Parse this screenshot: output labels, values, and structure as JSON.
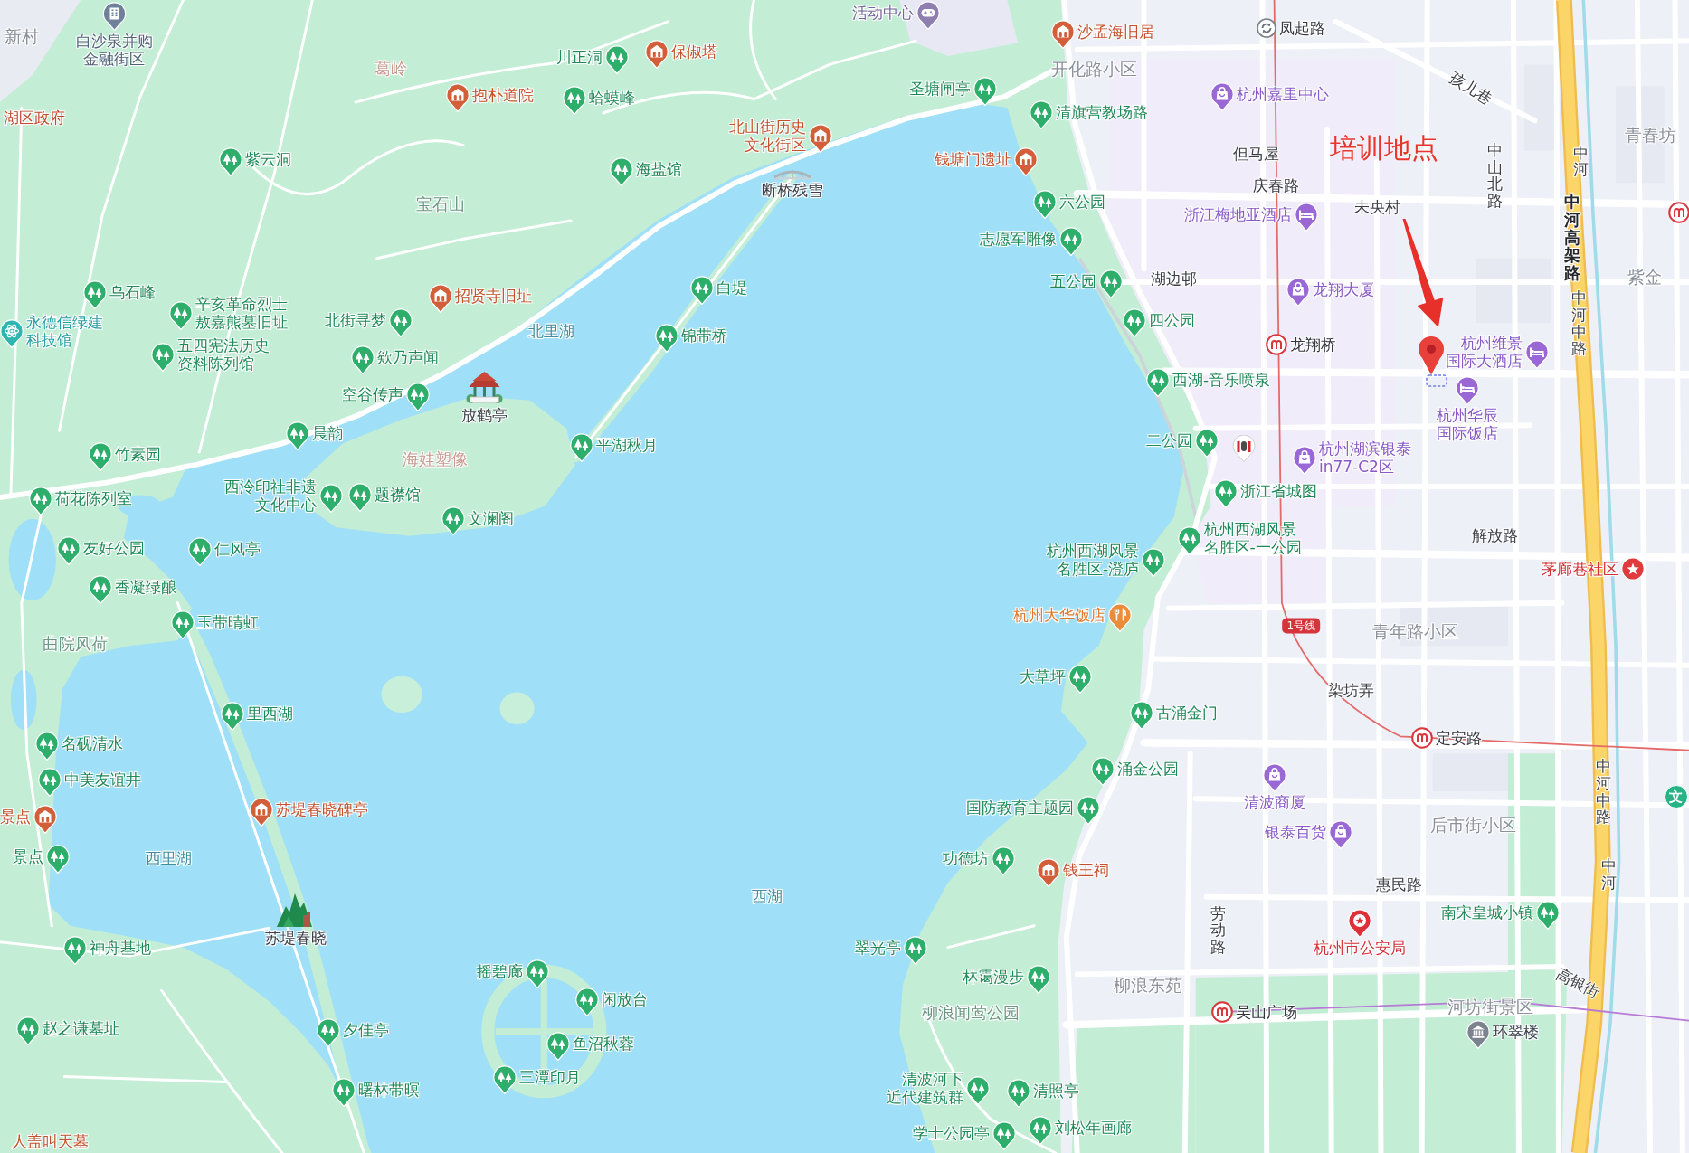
{
  "map": {
    "places": [
      {
        "name": "活动中心",
        "kind": "youth_center"
      },
      {
        "lines": [
          "白沙泉并购",
          "金融街区"
        ],
        "kind": "office"
      },
      {
        "name": "沙孟海旧居",
        "kind": "heritage"
      },
      {
        "name": "凤起路",
        "kind": "roundabout"
      },
      {
        "name": "川正洞",
        "kind": "scenic"
      },
      {
        "name": "保俶塔",
        "kind": "heritage"
      },
      {
        "name": "抱朴道院",
        "kind": "heritage"
      },
      {
        "name": "蛤蟆峰",
        "kind": "scenic"
      },
      {
        "name": "圣塘闸亭",
        "kind": "scenic"
      },
      {
        "name": "杭州嘉里中心",
        "kind": "shop"
      },
      {
        "lines": [
          "北山街历史",
          "文化街区"
        ],
        "kind": "heritage"
      },
      {
        "name": "清旗营教场路",
        "kind": "scenic"
      },
      {
        "name": "紫云洞",
        "kind": "scenic"
      },
      {
        "name": "海盐馆",
        "kind": "scenic"
      },
      {
        "name": "断桥残雪",
        "kind": "bridge"
      },
      {
        "name": "钱塘门遗址",
        "kind": "heritage"
      },
      {
        "name": "六公园",
        "kind": "scenic"
      },
      {
        "name": "浙江梅地亚酒店",
        "kind": "hotel"
      },
      {
        "kind": "metro"
      },
      {
        "name": "志愿军雕像",
        "kind": "scenic"
      },
      {
        "name": "乌石峰",
        "kind": "scenic"
      },
      {
        "lines": [
          "永德信绿建",
          "科技馆"
        ],
        "kind": "science"
      },
      {
        "lines": [
          "辛亥革命烈士",
          "敖嘉熊墓旧址"
        ],
        "kind": "scenic"
      },
      {
        "name": "招贤寺旧址",
        "kind": "heritage"
      },
      {
        "name": "白堤",
        "kind": "scenic"
      },
      {
        "name": "五公园",
        "kind": "scenic"
      },
      {
        "name": "龙翔大厦",
        "kind": "shop"
      },
      {
        "name": "北街寻梦",
        "kind": "scenic"
      },
      {
        "lines": [
          "五四宪法历史",
          "资料陈列馆"
        ],
        "kind": "scenic"
      },
      {
        "name": "欸乃声闻",
        "kind": "scenic"
      },
      {
        "name": "锦带桥",
        "kind": "scenic"
      },
      {
        "name": "四公园",
        "kind": "scenic"
      },
      {
        "name": "龙翔桥",
        "kind": "metro"
      },
      {
        "lines": [
          "杭州维景",
          "国际大酒店"
        ],
        "kind": "hotel"
      },
      {
        "name": "空谷传声",
        "kind": "scenic"
      },
      {
        "name": "西湖-音乐喷泉",
        "kind": "scenic"
      },
      {
        "name": "放鹤亭",
        "kind": "pavilion"
      },
      {
        "name": "晨韵",
        "kind": "scenic"
      },
      {
        "name": "竹素园",
        "kind": "scenic"
      },
      {
        "name": "平湖秋月",
        "kind": "scenic"
      },
      {
        "name": "二公园",
        "kind": "scenic"
      },
      {
        "kind": "fast_food"
      },
      {
        "lines": [
          "杭州湖滨银泰",
          "in77-C2区"
        ],
        "kind": "shop"
      },
      {
        "lines": [
          "杭州华辰",
          "国际饭店"
        ],
        "kind": "hotel"
      },
      {
        "name": "荷花陈列室",
        "kind": "scenic"
      },
      {
        "lines": [
          "西泠印社非遗",
          "文化中心"
        ],
        "kind": "scenic"
      },
      {
        "name": "题襟馆",
        "kind": "scenic"
      },
      {
        "name": "浙江省城图",
        "kind": "scenic"
      },
      {
        "name": "文澜阁",
        "kind": "scenic"
      },
      {
        "name": "友好公园",
        "kind": "scenic"
      },
      {
        "name": "仁风亭",
        "kind": "scenic"
      },
      {
        "lines": [
          "杭州西湖风景",
          "名胜区-澄庐"
        ],
        "kind": "scenic"
      },
      {
        "lines": [
          "杭州西湖风景",
          "名胜区-一公园"
        ],
        "kind": "scenic"
      },
      {
        "name": "茅廊巷社区",
        "kind": "community"
      },
      {
        "name": "香凝绿酿",
        "kind": "scenic"
      },
      {
        "name": "玉带晴虹",
        "kind": "scenic"
      },
      {
        "name": "杭州大华饭店",
        "kind": "restaurant"
      },
      {
        "name": "大草坪",
        "kind": "scenic"
      },
      {
        "name": "里西湖",
        "kind": "scenic"
      },
      {
        "name": "古涌金门",
        "kind": "scenic"
      },
      {
        "name": "名砚清水",
        "kind": "scenic"
      },
      {
        "name": "定安路",
        "kind": "metro"
      },
      {
        "name": "中美友谊井",
        "kind": "scenic"
      },
      {
        "name": "涌金公园",
        "kind": "scenic"
      },
      {
        "name": "景点",
        "kind": "heritage"
      },
      {
        "name": "苏堤春晓碑亭",
        "kind": "heritage"
      },
      {
        "name": "国防教育主题园",
        "kind": "scenic"
      },
      {
        "name": "清波商厦",
        "kind": "shop"
      },
      {
        "name": "文",
        "kind": "culture"
      },
      {
        "name": "银泰百货",
        "kind": "shop"
      },
      {
        "name": "景点",
        "kind": "scenic"
      },
      {
        "name": "功德坊",
        "kind": "scenic"
      },
      {
        "name": "钱王祠",
        "kind": "heritage"
      },
      {
        "name": "南宋皇城小镇",
        "kind": "scenic"
      },
      {
        "name": "神舟基地",
        "kind": "scenic"
      },
      {
        "name": "苏堤春晓",
        "kind": "mountain"
      },
      {
        "name": "翠光亭",
        "kind": "scenic"
      },
      {
        "name": "杭州市公安局",
        "kind": "police"
      },
      {
        "name": "摇碧廊",
        "kind": "scenic"
      },
      {
        "name": "林霭漫步",
        "kind": "scenic"
      },
      {
        "name": "闲放台",
        "kind": "scenic"
      },
      {
        "name": "赵之谦墓址",
        "kind": "scenic"
      },
      {
        "name": "夕佳亭",
        "kind": "scenic"
      },
      {
        "name": "吴山广场",
        "kind": "metro"
      },
      {
        "name": "鱼沼秋蓉",
        "kind": "scenic"
      },
      {
        "name": "环翠楼",
        "kind": "museum"
      },
      {
        "name": "曙林带暝",
        "kind": "scenic"
      },
      {
        "name": "三潭印月",
        "kind": "scenic"
      },
      {
        "lines": [
          "清波河下",
          "近代建筑群"
        ],
        "kind": "scenic"
      },
      {
        "name": "清照亭",
        "kind": "scenic"
      },
      {
        "name": "学士公园亭",
        "kind": "scenic"
      },
      {
        "name": "刘松年画廊",
        "kind": "scenic"
      }
    ],
    "labels": [
      {
        "text": "新村",
        "kind": "area"
      },
      {
        "text": "葛岭",
        "kind": "historic"
      },
      {
        "text": "开化路小区",
        "kind": "area"
      },
      {
        "text": "孩儿巷",
        "kind": "road"
      },
      {
        "text": "湖区政府",
        "kind": "government"
      },
      {
        "text": "但马屋",
        "kind": "locality"
      },
      {
        "text": "庆春路",
        "kind": "road"
      },
      {
        "text": "宝石山",
        "kind": "hill"
      },
      {
        "text": "未央村",
        "kind": "locality"
      },
      {
        "text": "中山北路",
        "kind": "road"
      },
      {
        "text": "中河",
        "kind": "road"
      },
      {
        "text": "青春坊",
        "kind": "area"
      },
      {
        "text": "湖边邨",
        "kind": "locality"
      },
      {
        "text": "中河高架路",
        "kind": "highway"
      },
      {
        "text": "紫金",
        "kind": "area"
      },
      {
        "text": "北里湖",
        "kind": "water"
      },
      {
        "text": "中河中路",
        "kind": "road"
      },
      {
        "text": "海娃塑像",
        "kind": "historic"
      },
      {
        "text": "解放路",
        "kind": "road"
      },
      {
        "text": "曲院风荷",
        "kind": "hill"
      },
      {
        "text": "1号线",
        "kind": "line_badge"
      },
      {
        "text": "青年路小区",
        "kind": "area"
      },
      {
        "text": "染坊弄",
        "kind": "road"
      },
      {
        "text": "后市街小区",
        "kind": "area"
      },
      {
        "text": "中河中路",
        "kind": "road"
      },
      {
        "text": "西里湖",
        "kind": "water"
      },
      {
        "text": "西湖",
        "kind": "water"
      },
      {
        "text": "惠民路",
        "kind": "road"
      },
      {
        "text": "中河",
        "kind": "road"
      },
      {
        "text": "劳动路",
        "kind": "road"
      },
      {
        "text": "柳浪东苑",
        "kind": "area"
      },
      {
        "text": "柳浪闻莺公园",
        "kind": "hill"
      },
      {
        "text": "河坊街景区",
        "kind": "area"
      },
      {
        "text": "高银街",
        "kind": "road"
      },
      {
        "text": "人盖叫天墓",
        "kind": "heritage"
      }
    ]
  },
  "annotation": {
    "text": "培训地点"
  }
}
